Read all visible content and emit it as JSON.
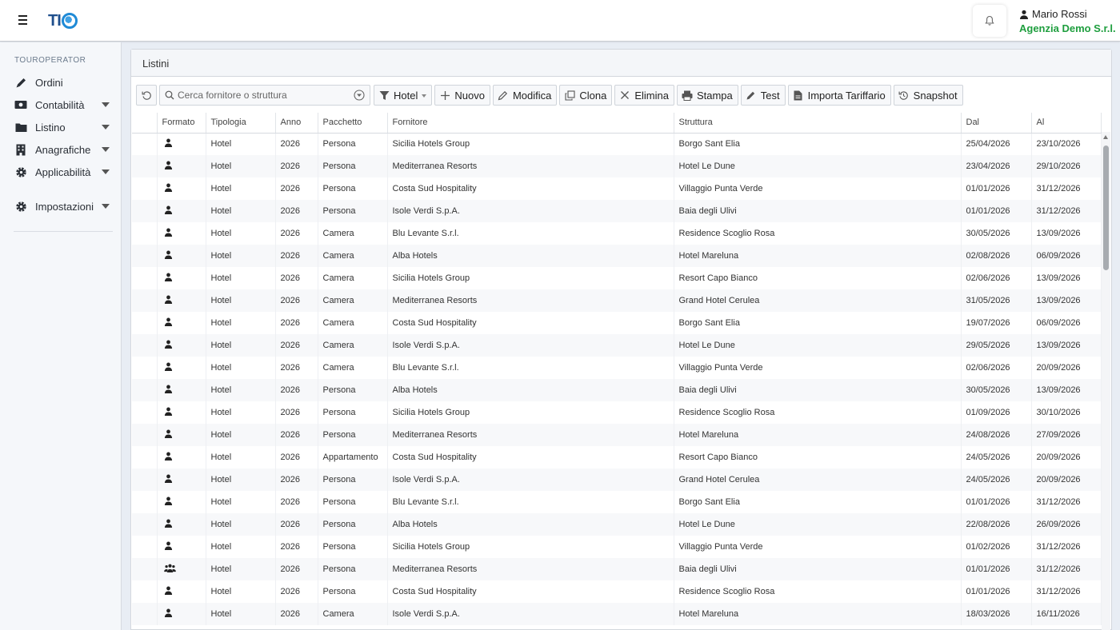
{
  "header": {
    "logo_text": "TI",
    "user_name": "Mario Rossi",
    "company": "Agenzia Demo S.r.l."
  },
  "sidebar": {
    "section": "TOUROPERATOR",
    "items": [
      {
        "label": "Ordini",
        "icon": "pencil-icon",
        "has_submenu": false
      },
      {
        "label": "Contabilità",
        "icon": "money-icon",
        "has_submenu": true
      },
      {
        "label": "Listino",
        "icon": "folder-icon",
        "has_submenu": true
      },
      {
        "label": "Anagrafiche",
        "icon": "building-icon",
        "has_submenu": true
      },
      {
        "label": "Applicabilità",
        "icon": "gear-icon",
        "has_submenu": true
      }
    ],
    "settings": {
      "label": "Impostazioni",
      "icon": "gear-icon",
      "has_submenu": true
    }
  },
  "panel": {
    "title": "Listini"
  },
  "toolbar": {
    "search_placeholder": "Cerca fornitore o struttura",
    "filter_label": "Hotel",
    "new_label": "Nuovo",
    "edit_label": "Modifica",
    "clone_label": "Clona",
    "delete_label": "Elimina",
    "print_label": "Stampa",
    "test_label": "Test",
    "import_label": "Importa Tariffario",
    "snapshot_label": "Snapshot"
  },
  "table": {
    "columns": [
      "Formato",
      "Tipologia",
      "Anno",
      "Pacchetto",
      "Fornitore",
      "Struttura",
      "Dal",
      "Al"
    ],
    "rows": [
      {
        "formato": "person-icon",
        "tipologia": "Hotel",
        "anno": "2026",
        "pacchetto": "Persona",
        "fornitore": "Sicilia Hotels Group",
        "struttura": "Borgo Sant Elia",
        "dal": "25/04/2026",
        "al": "23/10/2026"
      },
      {
        "formato": "person-icon",
        "tipologia": "Hotel",
        "anno": "2026",
        "pacchetto": "Persona",
        "fornitore": "Mediterranea Resorts",
        "struttura": "Hotel Le Dune",
        "dal": "23/04/2026",
        "al": "29/10/2026"
      },
      {
        "formato": "person-icon",
        "tipologia": "Hotel",
        "anno": "2026",
        "pacchetto": "Persona",
        "fornitore": "Costa Sud Hospitality",
        "struttura": "Villaggio Punta Verde",
        "dal": "01/01/2026",
        "al": "31/12/2026"
      },
      {
        "formato": "person-icon",
        "tipologia": "Hotel",
        "anno": "2026",
        "pacchetto": "Persona",
        "fornitore": "Isole Verdi S.p.A.",
        "struttura": "Baia degli Ulivi",
        "dal": "01/01/2026",
        "al": "31/12/2026"
      },
      {
        "formato": "person-icon",
        "tipologia": "Hotel",
        "anno": "2026",
        "pacchetto": "Camera",
        "fornitore": "Blu Levante S.r.l.",
        "struttura": "Residence Scoglio Rosa",
        "dal": "30/05/2026",
        "al": "13/09/2026"
      },
      {
        "formato": "person-icon",
        "tipologia": "Hotel",
        "anno": "2026",
        "pacchetto": "Camera",
        "fornitore": "Alba Hotels",
        "struttura": "Hotel Mareluna",
        "dal": "02/08/2026",
        "al": "06/09/2026"
      },
      {
        "formato": "person-icon",
        "tipologia": "Hotel",
        "anno": "2026",
        "pacchetto": "Camera",
        "fornitore": "Sicilia Hotels Group",
        "struttura": "Resort Capo Bianco",
        "dal": "02/06/2026",
        "al": "13/09/2026"
      },
      {
        "formato": "person-icon",
        "tipologia": "Hotel",
        "anno": "2026",
        "pacchetto": "Camera",
        "fornitore": "Mediterranea Resorts",
        "struttura": "Grand Hotel Cerulea",
        "dal": "31/05/2026",
        "al": "13/09/2026"
      },
      {
        "formato": "person-icon",
        "tipologia": "Hotel",
        "anno": "2026",
        "pacchetto": "Camera",
        "fornitore": "Costa Sud Hospitality",
        "struttura": "Borgo Sant Elia",
        "dal": "19/07/2026",
        "al": "06/09/2026"
      },
      {
        "formato": "person-icon",
        "tipologia": "Hotel",
        "anno": "2026",
        "pacchetto": "Camera",
        "fornitore": "Isole Verdi S.p.A.",
        "struttura": "Hotel Le Dune",
        "dal": "29/05/2026",
        "al": "13/09/2026"
      },
      {
        "formato": "person-icon",
        "tipologia": "Hotel",
        "anno": "2026",
        "pacchetto": "Camera",
        "fornitore": "Blu Levante S.r.l.",
        "struttura": "Villaggio Punta Verde",
        "dal": "02/06/2026",
        "al": "20/09/2026"
      },
      {
        "formato": "person-icon",
        "tipologia": "Hotel",
        "anno": "2026",
        "pacchetto": "Persona",
        "fornitore": "Alba Hotels",
        "struttura": "Baia degli Ulivi",
        "dal": "30/05/2026",
        "al": "13/09/2026"
      },
      {
        "formato": "person-icon",
        "tipologia": "Hotel",
        "anno": "2026",
        "pacchetto": "Persona",
        "fornitore": "Sicilia Hotels Group",
        "struttura": "Residence Scoglio Rosa",
        "dal": "01/09/2026",
        "al": "30/10/2026"
      },
      {
        "formato": "person-icon",
        "tipologia": "Hotel",
        "anno": "2026",
        "pacchetto": "Persona",
        "fornitore": "Mediterranea Resorts",
        "struttura": "Hotel Mareluna",
        "dal": "24/08/2026",
        "al": "27/09/2026"
      },
      {
        "formato": "person-icon",
        "tipologia": "Hotel",
        "anno": "2026",
        "pacchetto": "Appartamento",
        "fornitore": "Costa Sud Hospitality",
        "struttura": "Resort Capo Bianco",
        "dal": "24/05/2026",
        "al": "20/09/2026"
      },
      {
        "formato": "person-icon",
        "tipologia": "Hotel",
        "anno": "2026",
        "pacchetto": "Persona",
        "fornitore": "Isole Verdi S.p.A.",
        "struttura": "Grand Hotel Cerulea",
        "dal": "24/05/2026",
        "al": "20/09/2026"
      },
      {
        "formato": "person-icon",
        "tipologia": "Hotel",
        "anno": "2026",
        "pacchetto": "Persona",
        "fornitore": "Blu Levante S.r.l.",
        "struttura": "Borgo Sant Elia",
        "dal": "01/01/2026",
        "al": "31/12/2026"
      },
      {
        "formato": "person-icon",
        "tipologia": "Hotel",
        "anno": "2026",
        "pacchetto": "Persona",
        "fornitore": "Alba Hotels",
        "struttura": "Hotel Le Dune",
        "dal": "22/08/2026",
        "al": "26/09/2026"
      },
      {
        "formato": "person-icon",
        "tipologia": "Hotel",
        "anno": "2026",
        "pacchetto": "Persona",
        "fornitore": "Sicilia Hotels Group",
        "struttura": "Villaggio Punta Verde",
        "dal": "01/02/2026",
        "al": "31/12/2026"
      },
      {
        "formato": "group-icon",
        "tipologia": "Hotel",
        "anno": "2026",
        "pacchetto": "Persona",
        "fornitore": "Mediterranea Resorts",
        "struttura": "Baia degli Ulivi",
        "dal": "01/01/2026",
        "al": "31/12/2026"
      },
      {
        "formato": "person-icon",
        "tipologia": "Hotel",
        "anno": "2026",
        "pacchetto": "Persona",
        "fornitore": "Costa Sud Hospitality",
        "struttura": "Residence Scoglio Rosa",
        "dal": "01/01/2026",
        "al": "31/12/2026"
      },
      {
        "formato": "person-icon",
        "tipologia": "Hotel",
        "anno": "2026",
        "pacchetto": "Camera",
        "fornitore": "Isole Verdi S.p.A.",
        "struttura": "Hotel Mareluna",
        "dal": "18/03/2026",
        "al": "16/11/2026"
      }
    ]
  },
  "colors": {
    "accent_green": "#1e9e3e",
    "logo_blue": "#1f4f8c",
    "globe_blue": "#1f8ad6"
  }
}
